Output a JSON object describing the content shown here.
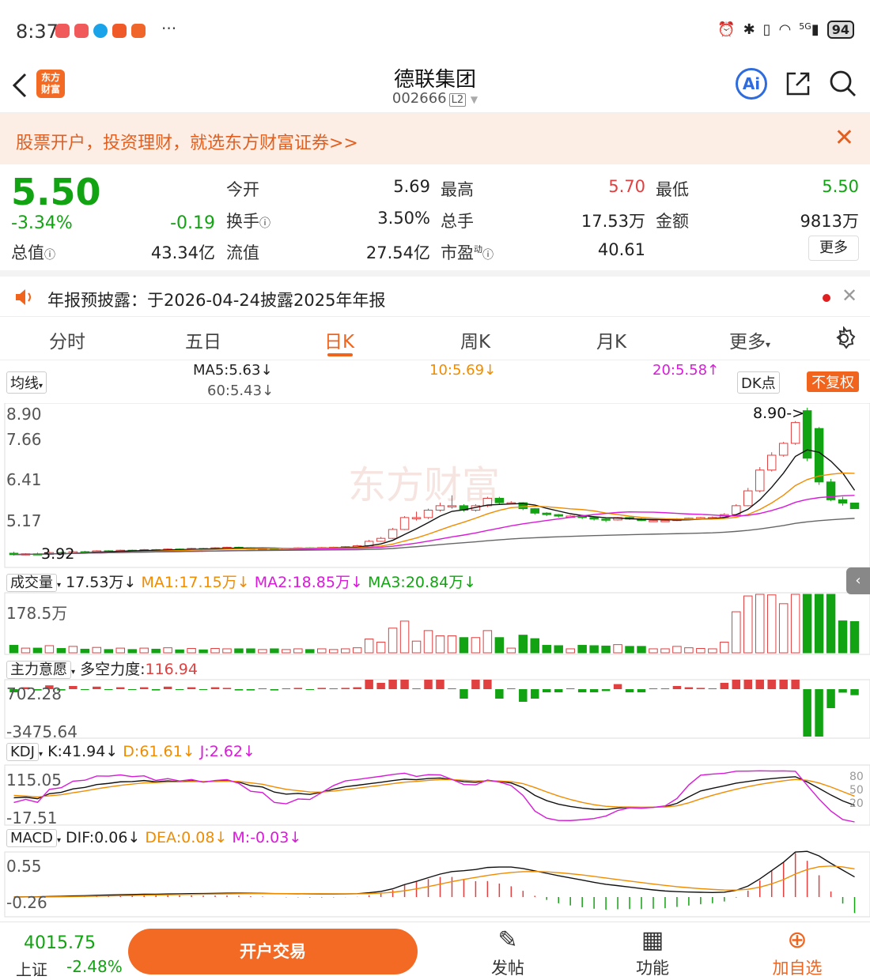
{
  "status_bar": {
    "time": "8:37",
    "battery": "94",
    "icons": [
      "alarm-icon",
      "bluetooth-icon",
      "vibrate-icon",
      "wifi-icon",
      "5g-signal-icon"
    ],
    "network": "5G"
  },
  "header": {
    "title": "德联集团",
    "code": "002666",
    "level": "L2",
    "logo_text": "东方财富"
  },
  "banner": {
    "text": "股票开户，投资理财，就选东方财富证券>>"
  },
  "quote": {
    "price": "5.50",
    "change_pct": "-3.34%",
    "change": "-0.19",
    "open_label": "今开",
    "open": "5.69",
    "high_label": "最高",
    "high": "5.70",
    "low_label": "最低",
    "low": "5.50",
    "turnover_label": "换手",
    "turnover": "3.50%",
    "volume_label": "总手",
    "volume": "17.53万",
    "amount_label": "金额",
    "amount": "9813万",
    "mktcap_label": "总值",
    "mktcap": "43.34亿",
    "float_label": "流值",
    "float": "27.54亿",
    "pe_label": "市盈",
    "pe_sup": "动",
    "pe": "40.61",
    "more": "更多"
  },
  "notice": {
    "text": "年报预披露：于2026-04-24披露2025年年报"
  },
  "period_tabs": [
    "分时",
    "五日",
    "日K",
    "周K",
    "月K",
    "更多"
  ],
  "active_tab": "日K",
  "kline": {
    "indicator": "均线",
    "ma5": "MA5:5.63↓",
    "ma10": "10:5.69↓",
    "ma20": "20:5.58↑",
    "ma60": "60:5.43↓",
    "dk": "DK点",
    "adjust": "不复权",
    "axis": [
      "8.90",
      "7.66",
      "6.41",
      "5.17"
    ],
    "high_mark": "8.90->",
    "low_mark": "3.92",
    "watermark": "东方财富"
  },
  "volume_panel": {
    "name": "成交量",
    "value": "17.53万↓",
    "ma1": "MA1:17.15万↓",
    "ma2": "MA2:18.85万↓",
    "ma3": "MA3:20.84万↓",
    "axis_max": "178.5万"
  },
  "force_panel": {
    "name": "主力意愿",
    "label": "多空力度:",
    "value": "116.94",
    "axis_max": "702.28",
    "axis_min": "-3475.64"
  },
  "kdj_panel": {
    "name": "KDJ",
    "k": "K:41.94↓",
    "d": "D:61.61↓",
    "j": "J:2.62↓",
    "axis_max": "115.05",
    "axis_min": "-17.51",
    "levels": [
      "80",
      "50",
      "20"
    ]
  },
  "macd_panel": {
    "name": "MACD",
    "dif": "DIF:0.06↓",
    "dea": "DEA:0.08↓",
    "m": "M:-0.03↓",
    "axis_max": "0.55",
    "axis_min": "-0.26"
  },
  "bottom": {
    "index_value": "4015.75",
    "index_name": "上证",
    "index_pct": "-2.48%",
    "trade": "开户交易",
    "post": "发帖",
    "func": "功能",
    "watch": "加自选"
  },
  "colors": {
    "up": "#e04040",
    "down": "#12a312",
    "accent": "#f36a25"
  },
  "chart_data": {
    "type": "candlestick",
    "count": 72,
    "opens": [
      4.0,
      3.95,
      3.98,
      3.96,
      4.02,
      4.0,
      4.05,
      4.04,
      4.08,
      4.07,
      4.1,
      4.09,
      4.12,
      4.1,
      4.14,
      4.13,
      4.16,
      4.15,
      4.18,
      4.2,
      4.18,
      4.16,
      4.17,
      4.15,
      4.16,
      4.18,
      4.17,
      4.19,
      4.2,
      4.22,
      4.25,
      4.4,
      4.5,
      4.8,
      5.2,
      5.2,
      5.45,
      5.6,
      5.6,
      5.45,
      5.6,
      5.85,
      5.7,
      5.7,
      5.5,
      5.35,
      5.3,
      5.25,
      5.25,
      5.2,
      5.15,
      5.12,
      5.2,
      5.15,
      5.1,
      5.1,
      5.1,
      5.15,
      5.18,
      5.2,
      5.2,
      5.3,
      5.6,
      6.1,
      6.8,
      7.3,
      7.7,
      8.8,
      8.2,
      6.4,
      5.8,
      5.69
    ],
    "closes": [
      3.95,
      3.98,
      3.96,
      4.02,
      4.0,
      4.05,
      4.04,
      4.08,
      4.07,
      4.1,
      4.09,
      4.12,
      4.1,
      4.14,
      4.13,
      4.16,
      4.15,
      4.18,
      4.2,
      4.18,
      4.16,
      4.17,
      4.15,
      4.16,
      4.18,
      4.17,
      4.19,
      4.2,
      4.22,
      4.25,
      4.4,
      4.5,
      4.8,
      5.2,
      5.2,
      5.45,
      5.6,
      5.6,
      5.45,
      5.6,
      5.85,
      5.7,
      5.7,
      5.5,
      5.35,
      5.3,
      5.25,
      5.25,
      5.2,
      5.15,
      5.12,
      5.2,
      5.15,
      5.1,
      5.1,
      5.1,
      5.15,
      5.18,
      5.2,
      5.2,
      5.3,
      5.6,
      6.1,
      6.8,
      7.3,
      7.7,
      8.4,
      7.2,
      6.4,
      5.8,
      5.69,
      5.5
    ],
    "highs": [
      4.05,
      4.0,
      4.02,
      4.05,
      4.05,
      4.08,
      4.08,
      4.1,
      4.1,
      4.12,
      4.12,
      4.14,
      4.14,
      4.16,
      4.16,
      4.18,
      4.18,
      4.2,
      4.22,
      4.22,
      4.2,
      4.19,
      4.19,
      4.18,
      4.2,
      4.2,
      4.21,
      4.22,
      4.24,
      4.28,
      4.45,
      4.55,
      4.85,
      5.25,
      5.4,
      5.5,
      5.7,
      5.95,
      5.65,
      5.65,
      5.9,
      5.9,
      5.75,
      5.72,
      5.52,
      5.38,
      5.32,
      5.28,
      5.28,
      5.22,
      5.18,
      5.22,
      5.22,
      5.18,
      5.14,
      5.13,
      5.18,
      5.2,
      5.22,
      5.24,
      5.35,
      5.65,
      6.2,
      6.9,
      7.4,
      7.75,
      8.45,
      8.9,
      8.25,
      6.5,
      5.9,
      5.7
    ],
    "lows": [
      3.92,
      3.93,
      3.94,
      3.94,
      3.98,
      3.98,
      4.02,
      4.02,
      4.05,
      4.05,
      4.07,
      4.07,
      4.09,
      4.09,
      4.12,
      4.12,
      4.14,
      4.14,
      4.16,
      4.16,
      4.14,
      4.14,
      4.13,
      4.13,
      4.14,
      4.15,
      4.15,
      4.17,
      4.18,
      4.2,
      4.24,
      4.38,
      4.48,
      4.78,
      5.1,
      5.15,
      5.4,
      5.5,
      5.4,
      5.4,
      5.55,
      5.65,
      5.65,
      5.45,
      5.3,
      5.25,
      5.2,
      5.2,
      5.15,
      5.1,
      5.05,
      5.1,
      5.12,
      5.08,
      5.06,
      5.05,
      5.08,
      5.12,
      5.15,
      5.16,
      5.18,
      5.28,
      5.58,
      6.05,
      6.75,
      7.25,
      7.65,
      7.1,
      6.3,
      5.75,
      5.6,
      5.5
    ]
  }
}
